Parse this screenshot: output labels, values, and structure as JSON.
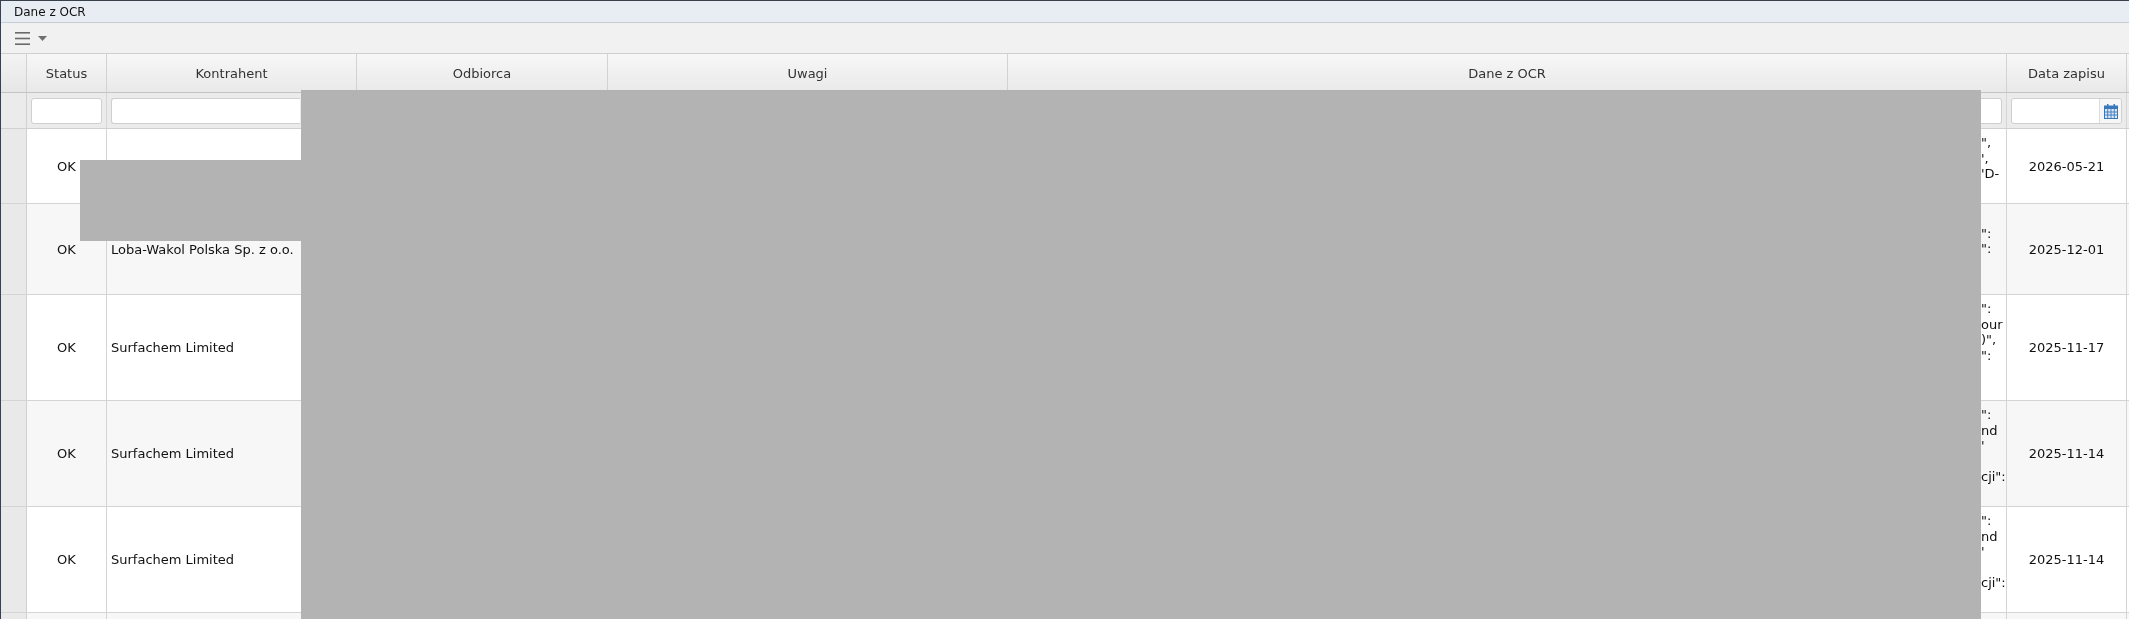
{
  "window": {
    "title": "Dane z OCR"
  },
  "table": {
    "columns": [
      {
        "label": "Status",
        "kind": "text"
      },
      {
        "label": "Kontrahent",
        "kind": "text"
      },
      {
        "label": "Odbiorca"
      },
      {
        "label": "Uwagi"
      },
      {
        "label": "Dane z OCR",
        "kind": "text"
      },
      {
        "label": "Data zapisu",
        "kind": "date"
      }
    ],
    "rows": [
      {
        "status": "OK",
        "dane_z_ocr": "\",\n',\n'D-",
        "data_zapisu": "2026-05-21"
      },
      {
        "status": "OK",
        "kontrahent": "Loba-Wakol Polska Sp. z o.o.",
        "dane_z_ocr": "\":\n\":",
        "data_zapisu": "2025-12-01"
      },
      {
        "status": "OK",
        "kontrahent": "Surfachem Limited",
        "dane_z_ocr": "\":\nour\n)\",\n\":",
        "data_zapisu": "2025-11-17"
      },
      {
        "status": "OK",
        "kontrahent": "Surfachem Limited",
        "dane_z_ocr": "\":\nnd\n'\n\ncji\":",
        "data_zapisu": "2025-11-14"
      },
      {
        "status": "OK",
        "kontrahent": "Surfachem Limited",
        "dane_z_ocr": "\":\nnd\n'\n\ncji\":",
        "data_zapisu": "2025-11-14"
      }
    ]
  }
}
